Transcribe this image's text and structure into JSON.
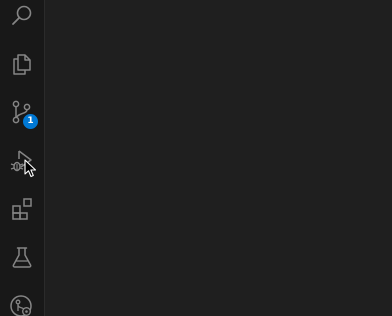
{
  "activity_bar": {
    "items": [
      {
        "id": "search",
        "icon": "search-icon",
        "active": false
      },
      {
        "id": "explorer",
        "icon": "files-icon",
        "active": false
      },
      {
        "id": "source-control",
        "icon": "source-control-icon",
        "active": false,
        "badge": "1"
      },
      {
        "id": "run-and-debug",
        "icon": "run-debug-icon",
        "active": false
      },
      {
        "id": "extensions",
        "icon": "extensions-icon",
        "active": false
      },
      {
        "id": "testing",
        "icon": "beaker-icon",
        "active": false
      },
      {
        "id": "remote-explorer",
        "icon": "remote-explorer-icon",
        "active": false
      }
    ]
  },
  "colors": {
    "activity_bar_bg": "#181818",
    "editor_bg": "#1f1f1f",
    "icon": "#858585",
    "badge_bg": "#0078d4",
    "badge_fg": "#ffffff"
  }
}
